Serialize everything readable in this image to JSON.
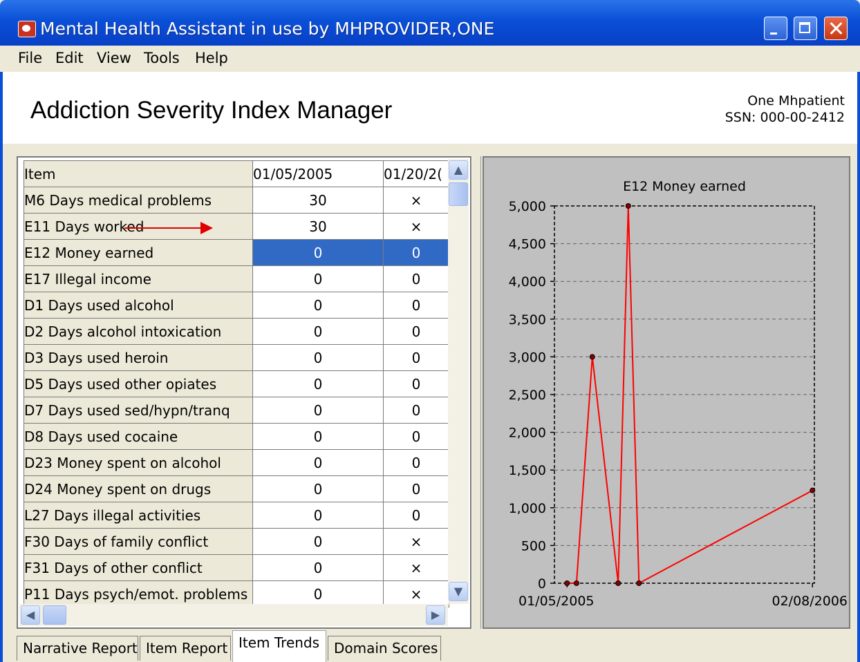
{
  "window": {
    "title": "Mental Health Assistant in use by MHPROVIDER,ONE"
  },
  "menu": {
    "items": [
      "File",
      "Edit",
      "View",
      "Tools",
      "Help"
    ]
  },
  "header": {
    "title": "Addiction Severity Index Manager",
    "patient_name": "One Mhpatient",
    "patient_ssn": "SSN: 000-00-2412"
  },
  "table": {
    "columns": [
      "Item",
      "01/05/2005",
      "01/20/2("
    ],
    "selected_row": 2,
    "rows": [
      [
        "M6 Days medical problems",
        "30",
        "×"
      ],
      [
        "E11 Days worked",
        "30",
        "×"
      ],
      [
        "E12 Money earned",
        "0",
        "0"
      ],
      [
        "E17 Illegal income",
        "0",
        "0"
      ],
      [
        "D1 Days used alcohol",
        "0",
        "0"
      ],
      [
        "D2 Days alcohol intoxication",
        "0",
        "0"
      ],
      [
        "D3 Days used heroin",
        "0",
        "0"
      ],
      [
        "D5 Days used other opiates",
        "0",
        "0"
      ],
      [
        "D7 Days used sed/hypn/tranq",
        "0",
        "0"
      ],
      [
        "D8 Days used cocaine",
        "0",
        "0"
      ],
      [
        "D23 Money spent on alcohol",
        "0",
        "0"
      ],
      [
        "D24 Money spent on drugs",
        "0",
        "0"
      ],
      [
        "L27 Days illegal activities",
        "0",
        "0"
      ],
      [
        "F30 Days of family conflict",
        "0",
        "×"
      ],
      [
        "F31 Days of other conflict",
        "0",
        "×"
      ],
      [
        "P11 Days psych/emot. problems",
        "0",
        "×"
      ]
    ]
  },
  "tabs": [
    {
      "label": "Narrative Report",
      "active": false
    },
    {
      "label": "Item Report",
      "active": false
    },
    {
      "label": "Item Trends",
      "active": true
    },
    {
      "label": "Domain Scores",
      "active": false
    }
  ],
  "chart_data": {
    "type": "line",
    "title": "E12 Money earned",
    "xlabel": "",
    "ylabel": "",
    "ylim": [
      0,
      5000
    ],
    "yticks": [
      "5,000",
      "4,500",
      "4,000",
      "3,500",
      "3,000",
      "2,500",
      "2,000",
      "1,500",
      "1,000",
      "500",
      "0"
    ],
    "xticks": [
      "01/05/2005",
      "02/08/2006"
    ],
    "grid": true,
    "series": [
      {
        "color": "#ff0000",
        "x": [
          "2005-01-05",
          "2005-01-20",
          "2005-02-14",
          "2005-03-27",
          "2005-04-12",
          "2005-04-29",
          "2006-01-29"
        ],
        "y": [
          0,
          0,
          3000,
          0,
          5000,
          0,
          1230
        ]
      }
    ]
  }
}
